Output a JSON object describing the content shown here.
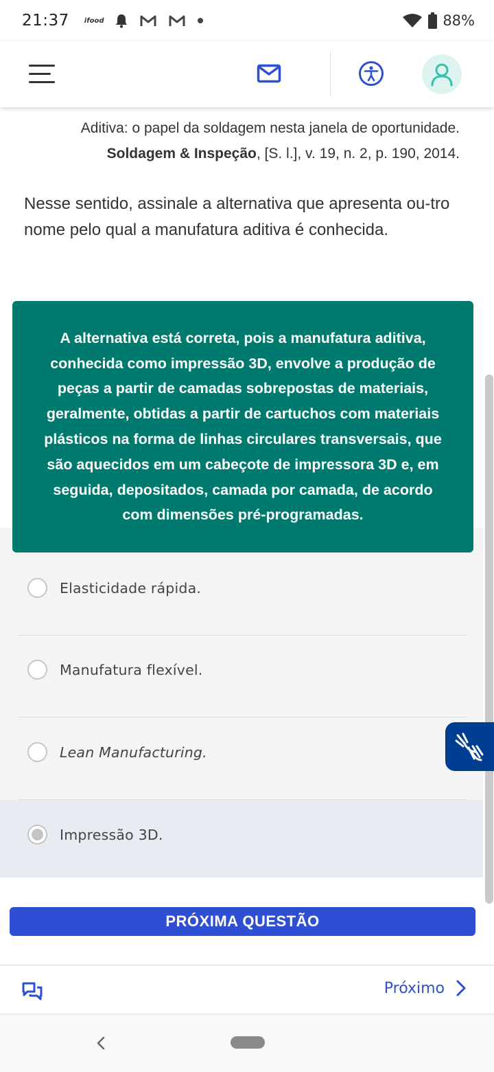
{
  "status_bar": {
    "time": "21:37",
    "ifood_label": "ifood",
    "battery": "88%",
    "icons": [
      "ifood-icon",
      "bell-icon",
      "gmail-icon",
      "gmail-icon",
      "dot-icon",
      "wifi-icon",
      "battery-icon"
    ]
  },
  "app_bar": {
    "icons": [
      "menu-icon",
      "mail-icon",
      "accessibility-icon",
      "avatar-user-icon"
    ],
    "colors": {
      "accent": "#2e4fd4",
      "avatar_bg": "#dcf3ef",
      "avatar_icon": "#35c0ad"
    }
  },
  "content": {
    "citation_line1": "Aditiva: o papel da soldagem nesta janela de oportunidade.",
    "citation_source": "Soldagem & Inspeção",
    "citation_rest": ", [S. l.], v. 19, n. 2, p. 190, 2014.",
    "question": "Nesse sentido, assinale a alternativa que apresenta ou-tro nome pelo qual a manufatura aditiva é conhecida.",
    "feedback": "A alternativa está correta, pois a manufatura aditiva, conhecida como impressão 3D, envolve a produção de peças a partir de camadas sobrepostas de materiais, geralmente, obtidas a partir de cartuchos com materiais plásticos na forma de linhas circulares transversais, que são aquecidos em um cabeçote de impressora 3D e, em seguida, depositados, camada por camada, de acordo com dimensões pré-programadas.",
    "feedback_color": "#007a6e"
  },
  "options": [
    {
      "label": "Elasticidade rápida.",
      "selected": false
    },
    {
      "label": "Manufatura flexível.",
      "selected": false
    },
    {
      "label": "Lean Manufacturing.",
      "selected": false
    },
    {
      "label": "Impressão 3D.",
      "selected": true
    }
  ],
  "next_question_button": "PRÓXIMA QUESTÃO",
  "bottom_bar": {
    "next_label": "Próximo",
    "icons": [
      "chat-icon",
      "chevron-right-icon"
    ]
  },
  "libras_icon": "sign-language-hands-icon",
  "nav_bar": {
    "icons": [
      "back-chevron-icon",
      "home-pill-icon"
    ]
  }
}
